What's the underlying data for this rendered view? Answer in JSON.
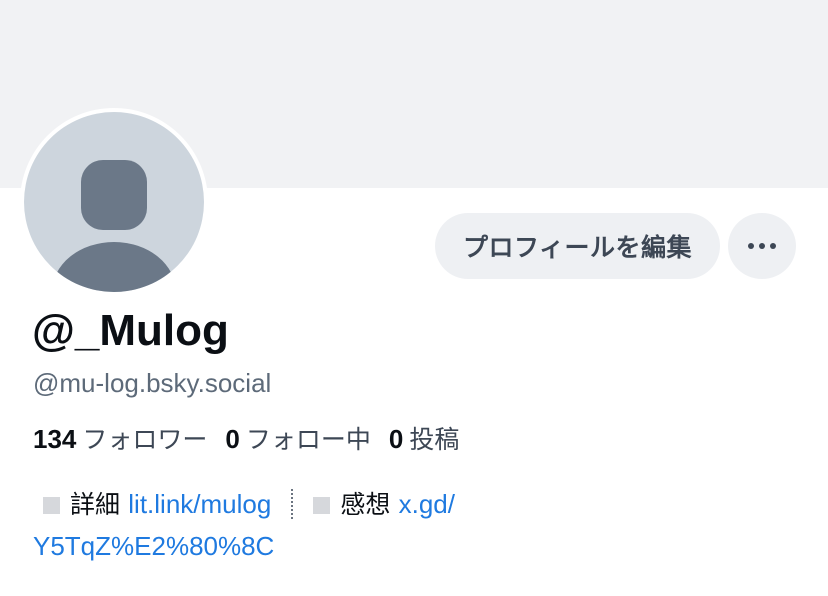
{
  "profile": {
    "display_name": "@_Mulog",
    "handle": "@mu-log.bsky.social"
  },
  "actions": {
    "edit_profile_label": "プロフィールを編集",
    "more_label": "•••"
  },
  "stats": [
    {
      "count": "134",
      "label": "フォロワー"
    },
    {
      "count": "0",
      "label": "フォロー中"
    },
    {
      "count": "0",
      "label": "投稿"
    }
  ],
  "bio": {
    "item1_label": "詳細",
    "item1_link": "lit.link/mulog",
    "item2_label": "感想",
    "item2_link_part1": "x.gd/",
    "item2_link_part2": "Y5TqZ%E2%80%8C"
  },
  "colors": {
    "banner": "#f1f2f4",
    "avatar_bg": "#cdd5dd",
    "avatar_figure": "#6b7888",
    "button_bg": "#eef0f3",
    "link": "#1f7ae0"
  },
  "icons": {
    "avatar": "default-avatar-icon",
    "more": "ellipsis-icon"
  }
}
